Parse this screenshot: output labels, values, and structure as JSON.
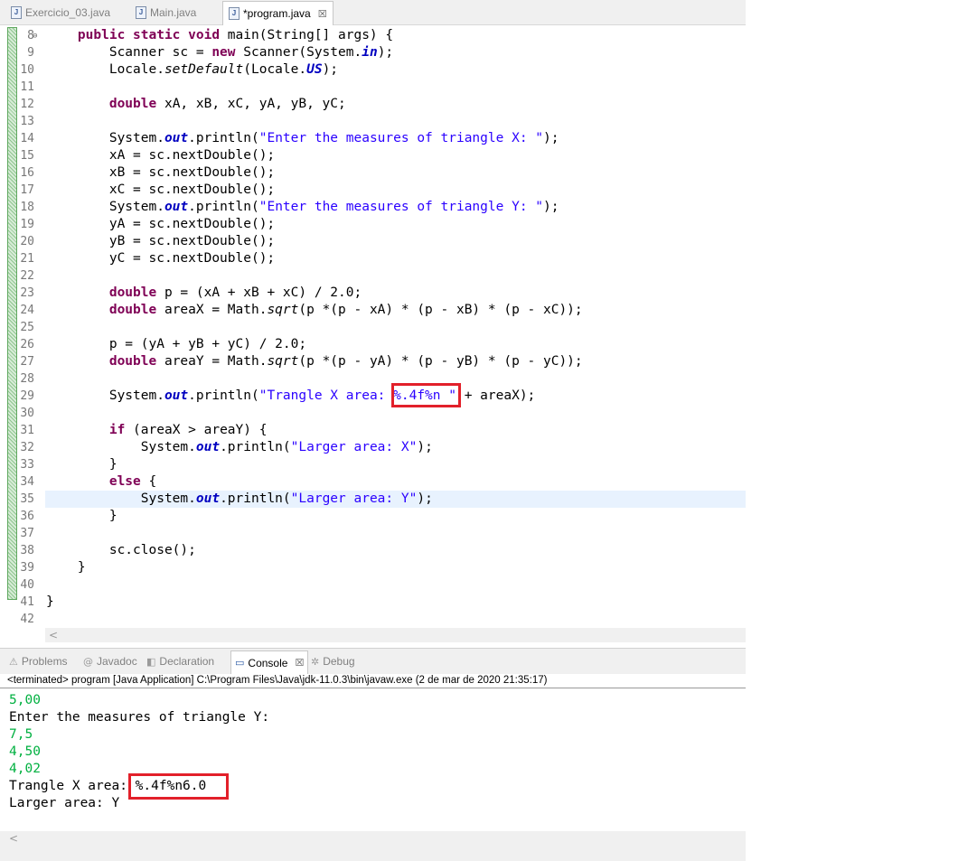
{
  "editor_tabs": [
    {
      "label": "Exercicio_03.java",
      "active": false
    },
    {
      "label": "Main.java",
      "active": false
    },
    {
      "label": "*program.java",
      "active": true,
      "close": "☒"
    }
  ],
  "code_lines": [
    {
      "n": "8",
      "fold": "⊖",
      "html": "    <span class='kw'>public static void</span> main(String[] args) {"
    },
    {
      "n": "9",
      "html": "        Scanner sc = <span class='kw'>new</span> Scanner(System.<span class='fld'>in</span>);"
    },
    {
      "n": "10",
      "html": "        Locale.<span class='mth'>setDefault</span>(Locale.<span class='fld'>US</span>);"
    },
    {
      "n": "11",
      "html": ""
    },
    {
      "n": "12",
      "html": "        <span class='kw'>double</span> xA, xB, xC, yA, yB, yC;"
    },
    {
      "n": "13",
      "html": ""
    },
    {
      "n": "14",
      "html": "        System.<span class='fld'>out</span>.println(<span class='str'>\"Enter the measures of triangle X: \"</span>);"
    },
    {
      "n": "15",
      "html": "        xA = sc.nextDouble();"
    },
    {
      "n": "16",
      "html": "        xB = sc.nextDouble();"
    },
    {
      "n": "17",
      "html": "        xC = sc.nextDouble();"
    },
    {
      "n": "18",
      "html": "        System.<span class='fld'>out</span>.println(<span class='str'>\"Enter the measures of triangle Y: \"</span>);"
    },
    {
      "n": "19",
      "html": "        yA = sc.nextDouble();"
    },
    {
      "n": "20",
      "html": "        yB = sc.nextDouble();"
    },
    {
      "n": "21",
      "html": "        yC = sc.nextDouble();"
    },
    {
      "n": "22",
      "html": ""
    },
    {
      "n": "23",
      "html": "        <span class='kw'>double</span> p = (xA + xB + xC) / 2.0;"
    },
    {
      "n": "24",
      "html": "        <span class='kw'>double</span> areaX = Math.<span class='mth'>sqrt</span>(p *(p - xA) * (p - xB) * (p - xC));"
    },
    {
      "n": "25",
      "html": ""
    },
    {
      "n": "26",
      "html": "        p = (yA + yB + yC) / 2.0;"
    },
    {
      "n": "27",
      "html": "        <span class='kw'>double</span> areaY = Math.<span class='mth'>sqrt</span>(p *(p - yA) * (p - yB) * (p - yC));"
    },
    {
      "n": "28",
      "html": ""
    },
    {
      "n": "29",
      "html": "        System.<span class='fld'>out</span>.println(<span class='str'>\"Trangle X area: %.4f%n \"</span> + areaX);"
    },
    {
      "n": "30",
      "html": ""
    },
    {
      "n": "31",
      "html": "        <span class='kw'>if</span> (areaX > areaY) {"
    },
    {
      "n": "32",
      "html": "            System.<span class='fld'>out</span>.println(<span class='str'>\"Larger area: X\"</span>);"
    },
    {
      "n": "33",
      "html": "        }"
    },
    {
      "n": "34",
      "html": "        <span class='kw'>else</span> {"
    },
    {
      "n": "35",
      "html": "            System.<span class='fld'>out</span>.println(<span class='str'>\"Larger area: Y\"</span>);",
      "current": true
    },
    {
      "n": "36",
      "html": "        }"
    },
    {
      "n": "37",
      "html": ""
    },
    {
      "n": "38",
      "html": "        sc.close();"
    },
    {
      "n": "39",
      "html": "    }"
    },
    {
      "n": "40",
      "html": ""
    },
    {
      "n": "41",
      "html": "}"
    },
    {
      "n": "42",
      "html": ""
    }
  ],
  "panel_tabs": [
    {
      "label": "Problems",
      "icon": "⚠",
      "name": "problems-icon"
    },
    {
      "label": "Javadoc",
      "icon": "@",
      "name": "javadoc-icon"
    },
    {
      "label": "Declaration",
      "icon": "◧",
      "name": "declaration-icon"
    },
    {
      "label": "Console",
      "icon": "▭",
      "name": "console-icon",
      "active": true,
      "close": "☒"
    },
    {
      "label": "Debug",
      "icon": "✲",
      "name": "debug-icon"
    }
  ],
  "console_status": "<terminated> program [Java Application] C:\\Program Files\\Java\\jdk-11.0.3\\bin\\javaw.exe (2 de mar de 2020 21:35:17)",
  "console_lines": [
    {
      "text": "5,00",
      "kind": "input"
    },
    {
      "text": "Enter the measures of triangle Y:",
      "kind": "output"
    },
    {
      "text": "7,5",
      "kind": "input"
    },
    {
      "text": "4,50",
      "kind": "input"
    },
    {
      "text": "4,02",
      "kind": "input"
    },
    {
      "text": "Trangle X area: %.4f%n6.0",
      "kind": "output"
    },
    {
      "text": "Larger area: Y",
      "kind": "output"
    }
  ],
  "scroll_left_arrow": "<",
  "colors": {
    "keyword": "#7f0055",
    "string": "#2a00ff",
    "field": "#0000c0",
    "console_input": "#00b040",
    "highlight": "#e2202a"
  }
}
